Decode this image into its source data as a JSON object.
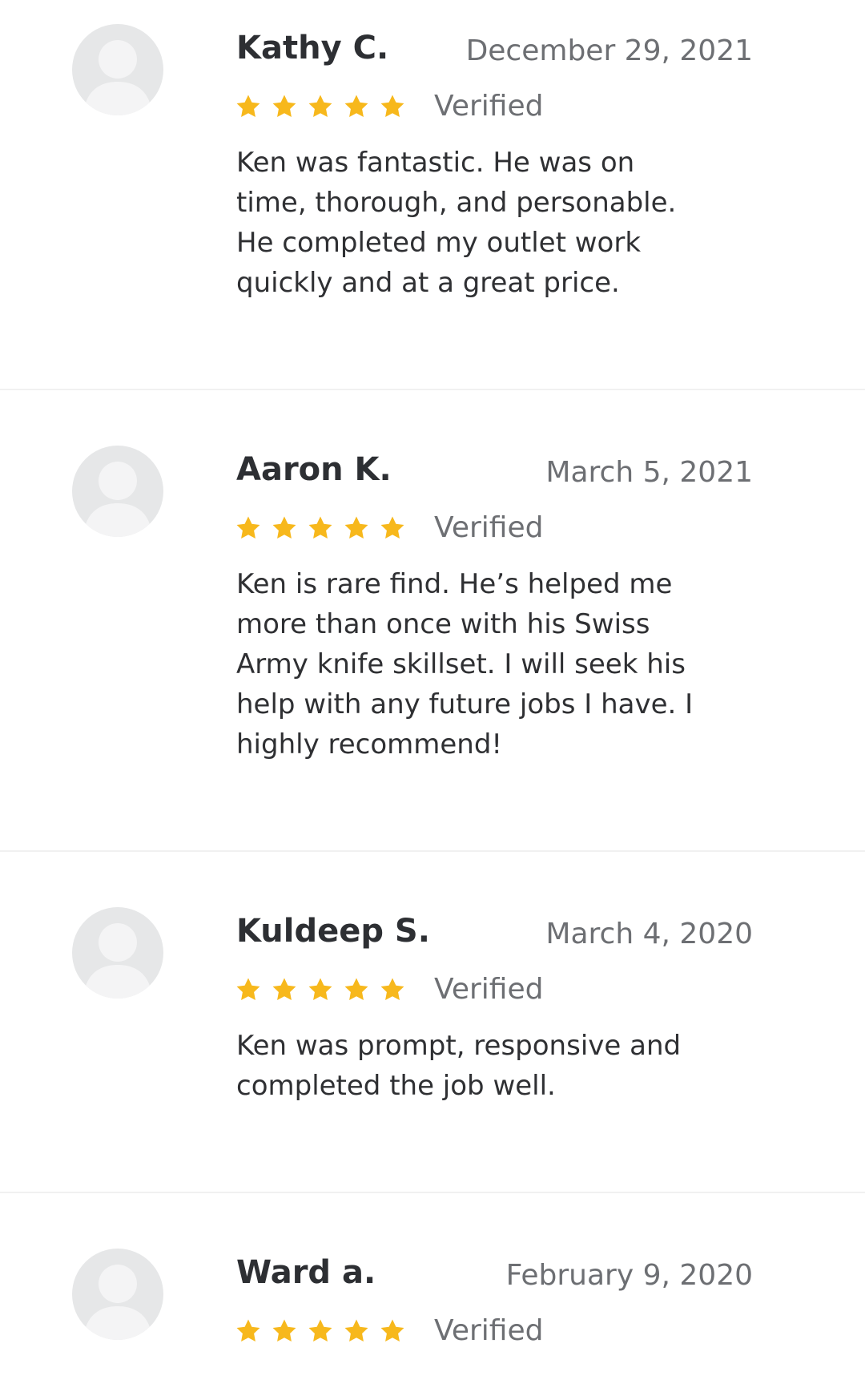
{
  "colors": {
    "star": "#f7b81c",
    "avatar_bg": "#e6e7e8",
    "avatar_fg": "#f4f4f5",
    "text": "#2f3033",
    "muted": "#6d6f73",
    "divider": "#f1f1f1"
  },
  "reviews": [
    {
      "name": "Kathy C.",
      "date": "December 29, 2021",
      "rating": 5,
      "verified_label": "Verified",
      "text": "Ken was fantastic.  He was on\ntime, thorough, and personable.\nHe completed my outlet work\nquickly and at a great price."
    },
    {
      "name": "Aaron K.",
      "date": "March 5, 2021",
      "rating": 5,
      "verified_label": "Verified",
      "text": "Ken is rare find. He’s helped me\nmore than once with his Swiss\nArmy knife skillset. I will seek his\nhelp with any future jobs I have. I\nhighly recommend!"
    },
    {
      "name": "Kuldeep S.",
      "date": "March 4, 2020",
      "rating": 5,
      "verified_label": "Verified",
      "text": "Ken was prompt, responsive and\ncompleted the job well."
    },
    {
      "name": "Ward a.",
      "date": "February 9, 2020",
      "rating": 5,
      "verified_label": "Verified",
      "text": ""
    }
  ]
}
